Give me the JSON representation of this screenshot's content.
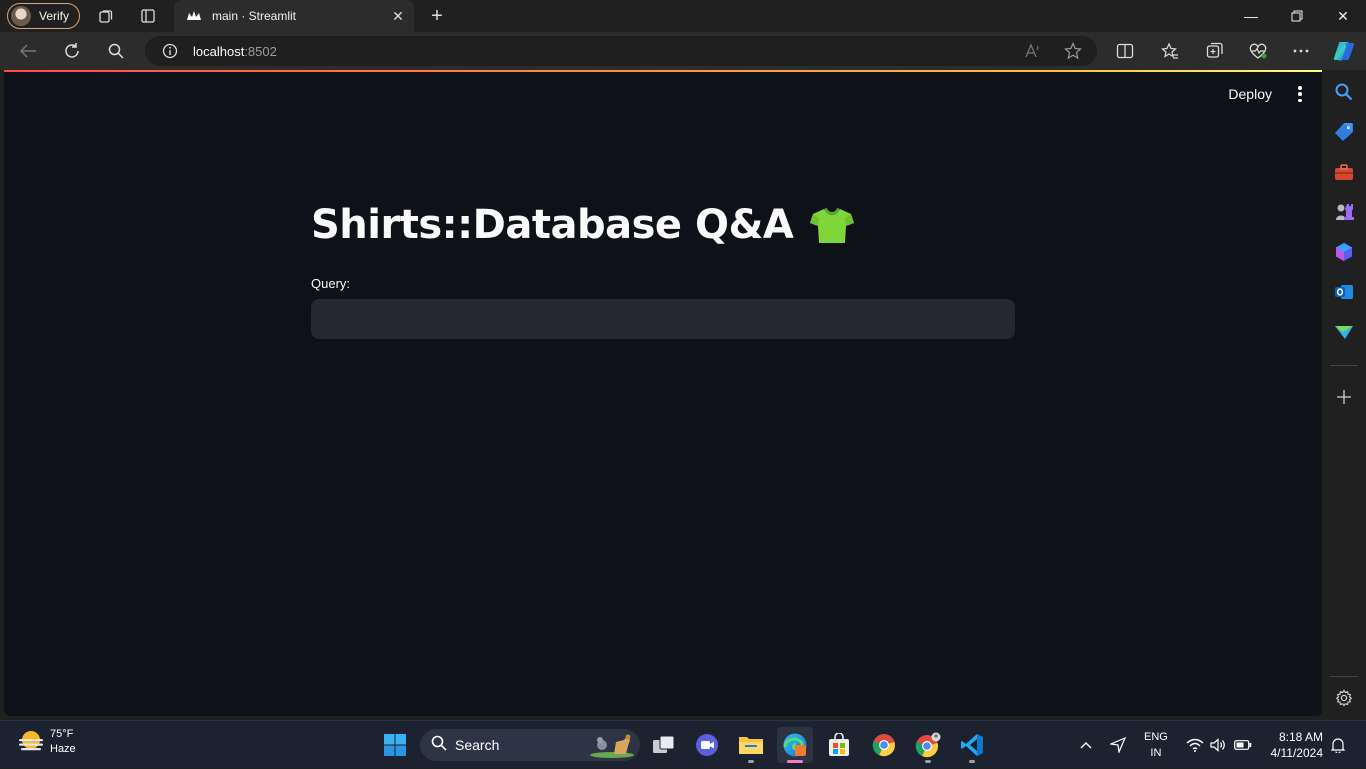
{
  "browser": {
    "profile_label": "Verify",
    "tab_title": "main · Streamlit",
    "url_host": "localhost",
    "url_port": ":8502"
  },
  "app": {
    "deploy_label": "Deploy",
    "title": "Shirts::Database Q&A",
    "title_emoji": "shirt-icon",
    "query_label": "Query:",
    "query_value": "",
    "accent": "#ff4b4b",
    "background": "#0e1117",
    "input_background": "#262730"
  },
  "taskbar": {
    "weather_temp": "75°F",
    "weather_desc": "Haze",
    "search_label": "Search",
    "lang_top": "ENG",
    "lang_bottom": "IN",
    "time": "8:18 AM",
    "date": "4/11/2024"
  }
}
